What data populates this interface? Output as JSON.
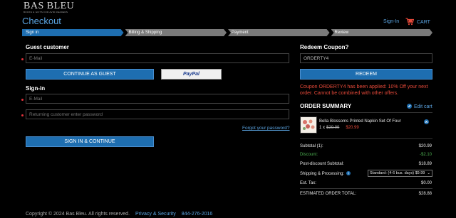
{
  "brand": {
    "name": "BAS BLEU",
    "tagline": "BOOKS & GIFTS FOR AVID READERS"
  },
  "header": {
    "title": "Checkout",
    "signin": "Sign-In",
    "cart": "CART",
    "cart_icon": "cart-icon"
  },
  "steps": [
    "Sign in",
    "Billing & Shipping",
    "Payment",
    "Review"
  ],
  "guest": {
    "title": "Guest customer",
    "email_placeholder": "E-Mail",
    "continue_label": "CONTINUE AS GUEST",
    "paypal_label": "PayPal"
  },
  "signin": {
    "title": "Sign-in",
    "email_placeholder": "E-Mail",
    "password_placeholder": "Returning customer enter password",
    "forgot_label": "Forgot your password?",
    "submit_label": "SIGN IN & CONTINUE"
  },
  "coupon": {
    "title": "Redeem Coupon?",
    "value": "ORDERTY4",
    "button": "REDEEM",
    "message": "Coupon ORDERTY4 has been applied: 10% Off your next order. Cannot be combined with other offers."
  },
  "order_summary": {
    "title": "ORDER SUMMARY",
    "edit_label": "Edit cart",
    "item": {
      "name": "Bella Blossoms Printed Napkin Set Of Four",
      "qty": "1 x",
      "old_price": "$29.99",
      "price": "$20.99"
    },
    "rows": [
      {
        "label": "Subtotal (1):",
        "value": "$20.99"
      },
      {
        "label": "Discount:",
        "value": "-$2.10"
      },
      {
        "label": "Post-discount Subtotal:",
        "value": "$18.89"
      },
      {
        "label": "Shipping & Processing:",
        "value": "Standard: (4-6 bus. days) $9.99"
      },
      {
        "label": "Est. Tax:",
        "value": "$0.00"
      },
      {
        "label": "ESTIMATED ORDER TOTAL:",
        "value": "$28.88"
      }
    ]
  },
  "footer": {
    "copyright": "Copyright © 2024 Bas Bleu. All rights reserved.",
    "privacy": "Privacy & Security",
    "phone": "844-276-2016"
  },
  "colors": {
    "accent": "#1e6eb0",
    "link": "#5aa3e0",
    "error": "#e84a3a",
    "discount": "#4caf50"
  }
}
